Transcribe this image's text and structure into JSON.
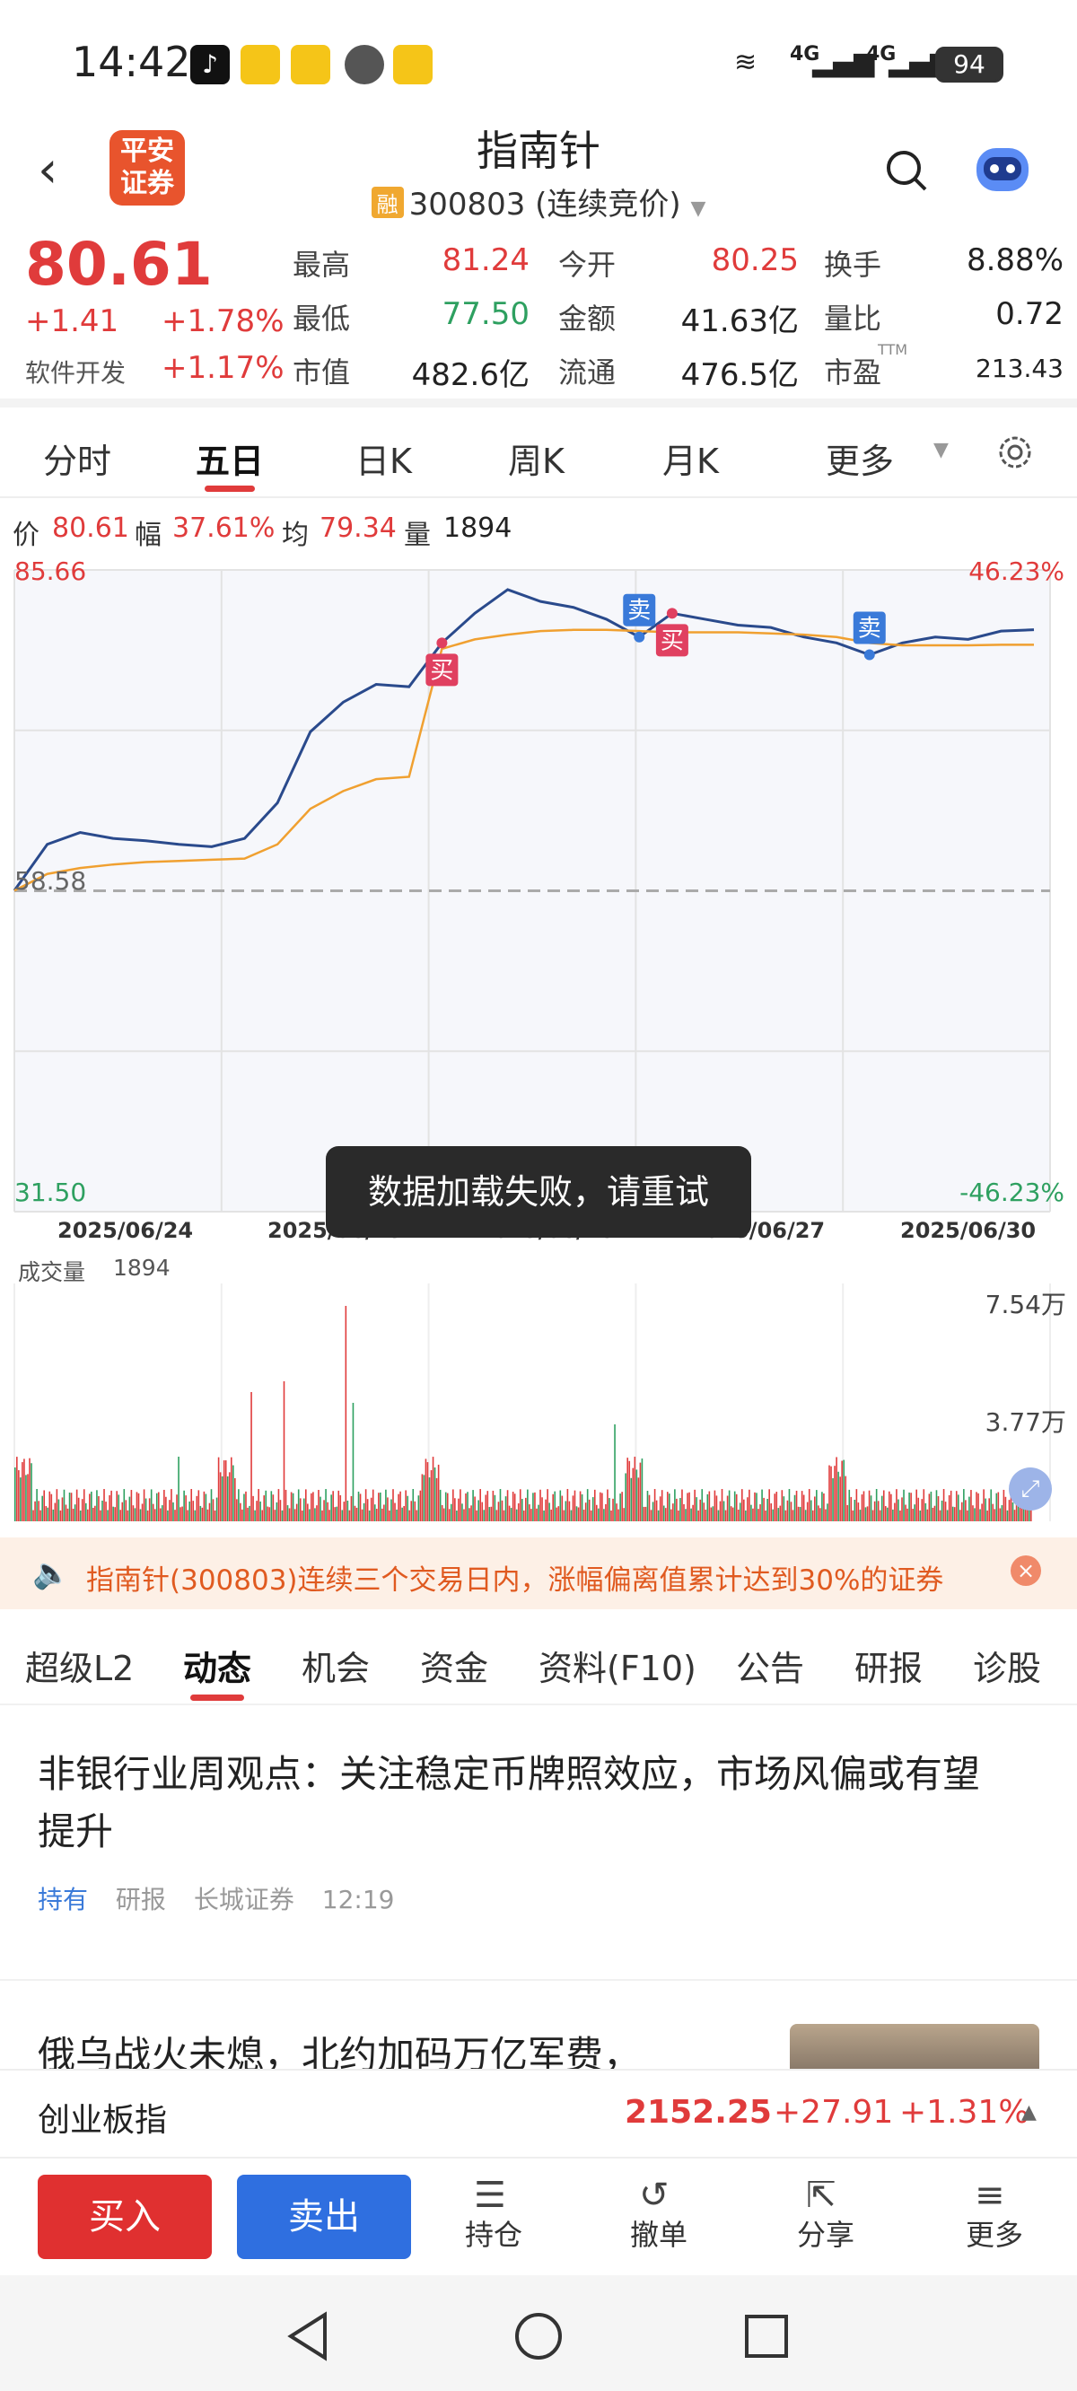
{
  "status_bar": {
    "time": "14:42",
    "network1": "4G",
    "network2": "4G",
    "battery": "94"
  },
  "header": {
    "logo_text": "平安证券",
    "title": "指南针",
    "rong_badge": "融",
    "subtitle": "300803 (连续竞价)"
  },
  "quote": {
    "price": "80.61",
    "change": "+1.41",
    "change_pct": "+1.78%",
    "sector_label": "软件开发",
    "sector_pct": "+1.17%",
    "high_label": "最高",
    "high": "81.24",
    "low_label": "最低",
    "low": "77.50",
    "mktcap_label": "市值",
    "mktcap": "482.6亿",
    "open_label": "今开",
    "open": "80.25",
    "amount_label": "金额",
    "amount": "41.63亿",
    "float_label": "流通",
    "float": "476.5亿",
    "turnover_label": "换手",
    "turnover": "8.88%",
    "volratio_label": "量比",
    "volratio": "0.72",
    "pe_label": "市盈",
    "pe_sup": "TTM",
    "pe": "213.43"
  },
  "tabs": [
    "分时",
    "五日",
    "日K",
    "周K",
    "月K",
    "更多"
  ],
  "chart_info": {
    "price_label": "价",
    "price": "80.61",
    "amp_label": "幅",
    "amp": "37.61%",
    "avg_label": "均",
    "avg": "79.34",
    "vol_label": "量",
    "vol": "1894"
  },
  "chart_axes": {
    "y_top": "85.66",
    "y_mid": "58.58",
    "y_bot": "31.50",
    "pct_top": "46.23%",
    "pct_bot": "-46.23%",
    "vol_title": "成交量",
    "vol_value": "1894",
    "vol_max": "7.54万",
    "vol_mid": "3.77万"
  },
  "chart_data": {
    "type": "line",
    "x_labels": [
      "2025/06/24",
      "2025/06/25",
      "2025/06/26",
      "2025/06/27",
      "2025/06/30"
    ],
    "ylim": [
      31.5,
      85.66
    ],
    "prev_close": 58.58,
    "series": [
      {
        "name": "价",
        "values": [
          58.6,
          62.5,
          63.5,
          63.0,
          62.8,
          62.5,
          62.3,
          63.0,
          66.0,
          72.0,
          74.5,
          76.0,
          75.8,
          79.5,
          82.0,
          84.0,
          83.0,
          82.5,
          81.5,
          80.0,
          82.0,
          81.5,
          81.0,
          80.8,
          80.0,
          79.5,
          78.5,
          79.5,
          80.0,
          79.8,
          80.5,
          80.61
        ]
      },
      {
        "name": "均",
        "values": [
          58.6,
          60.0,
          60.5,
          60.8,
          61.0,
          61.1,
          61.2,
          61.3,
          62.5,
          65.5,
          67.0,
          68.0,
          68.2,
          79.0,
          79.8,
          80.2,
          80.5,
          80.6,
          80.6,
          80.5,
          80.4,
          80.4,
          80.4,
          80.3,
          80.2,
          80.0,
          79.5,
          79.3,
          79.3,
          79.3,
          79.34,
          79.34
        ]
      }
    ],
    "markers": [
      {
        "label": "买",
        "point": 13
      },
      {
        "label": "卖",
        "point": 19
      },
      {
        "label": "买",
        "point": 20
      },
      {
        "label": "卖",
        "point": 26
      }
    ],
    "volume_ylim": [
      0,
      75400
    ]
  },
  "toast": "数据加载失败，请重试",
  "notice": "指南针(300803)连续三个交易日内，涨幅偏离值累计达到30%的证券",
  "subtabs": [
    "超级L2",
    "动态",
    "机会",
    "资金",
    "资料(F10)",
    "公告",
    "研报",
    "诊股"
  ],
  "news": [
    {
      "title": "非银行业周观点：关注稳定币牌照效应，市场风偏或有望提升",
      "tag": "持有",
      "type": "研报",
      "source": "长城证券",
      "time": "12:19"
    },
    {
      "title": "俄乌战火未熄，北约加码万亿军费，"
    }
  ],
  "index_bar": {
    "name": "创业板指",
    "value": "2152.25",
    "change": "+27.91",
    "pct": "+1.31%"
  },
  "bottom": {
    "buy": "买入",
    "sell": "卖出",
    "holdings": "持仓",
    "cancel": "撤单",
    "share": "分享",
    "more": "更多"
  },
  "colors": {
    "up": "#e03b3b",
    "down": "#2ea060",
    "price_line": "#2a4a8c",
    "avg_line": "#f0a030",
    "buy_btn": "#e03030",
    "sell_btn": "#2f6fe0"
  }
}
